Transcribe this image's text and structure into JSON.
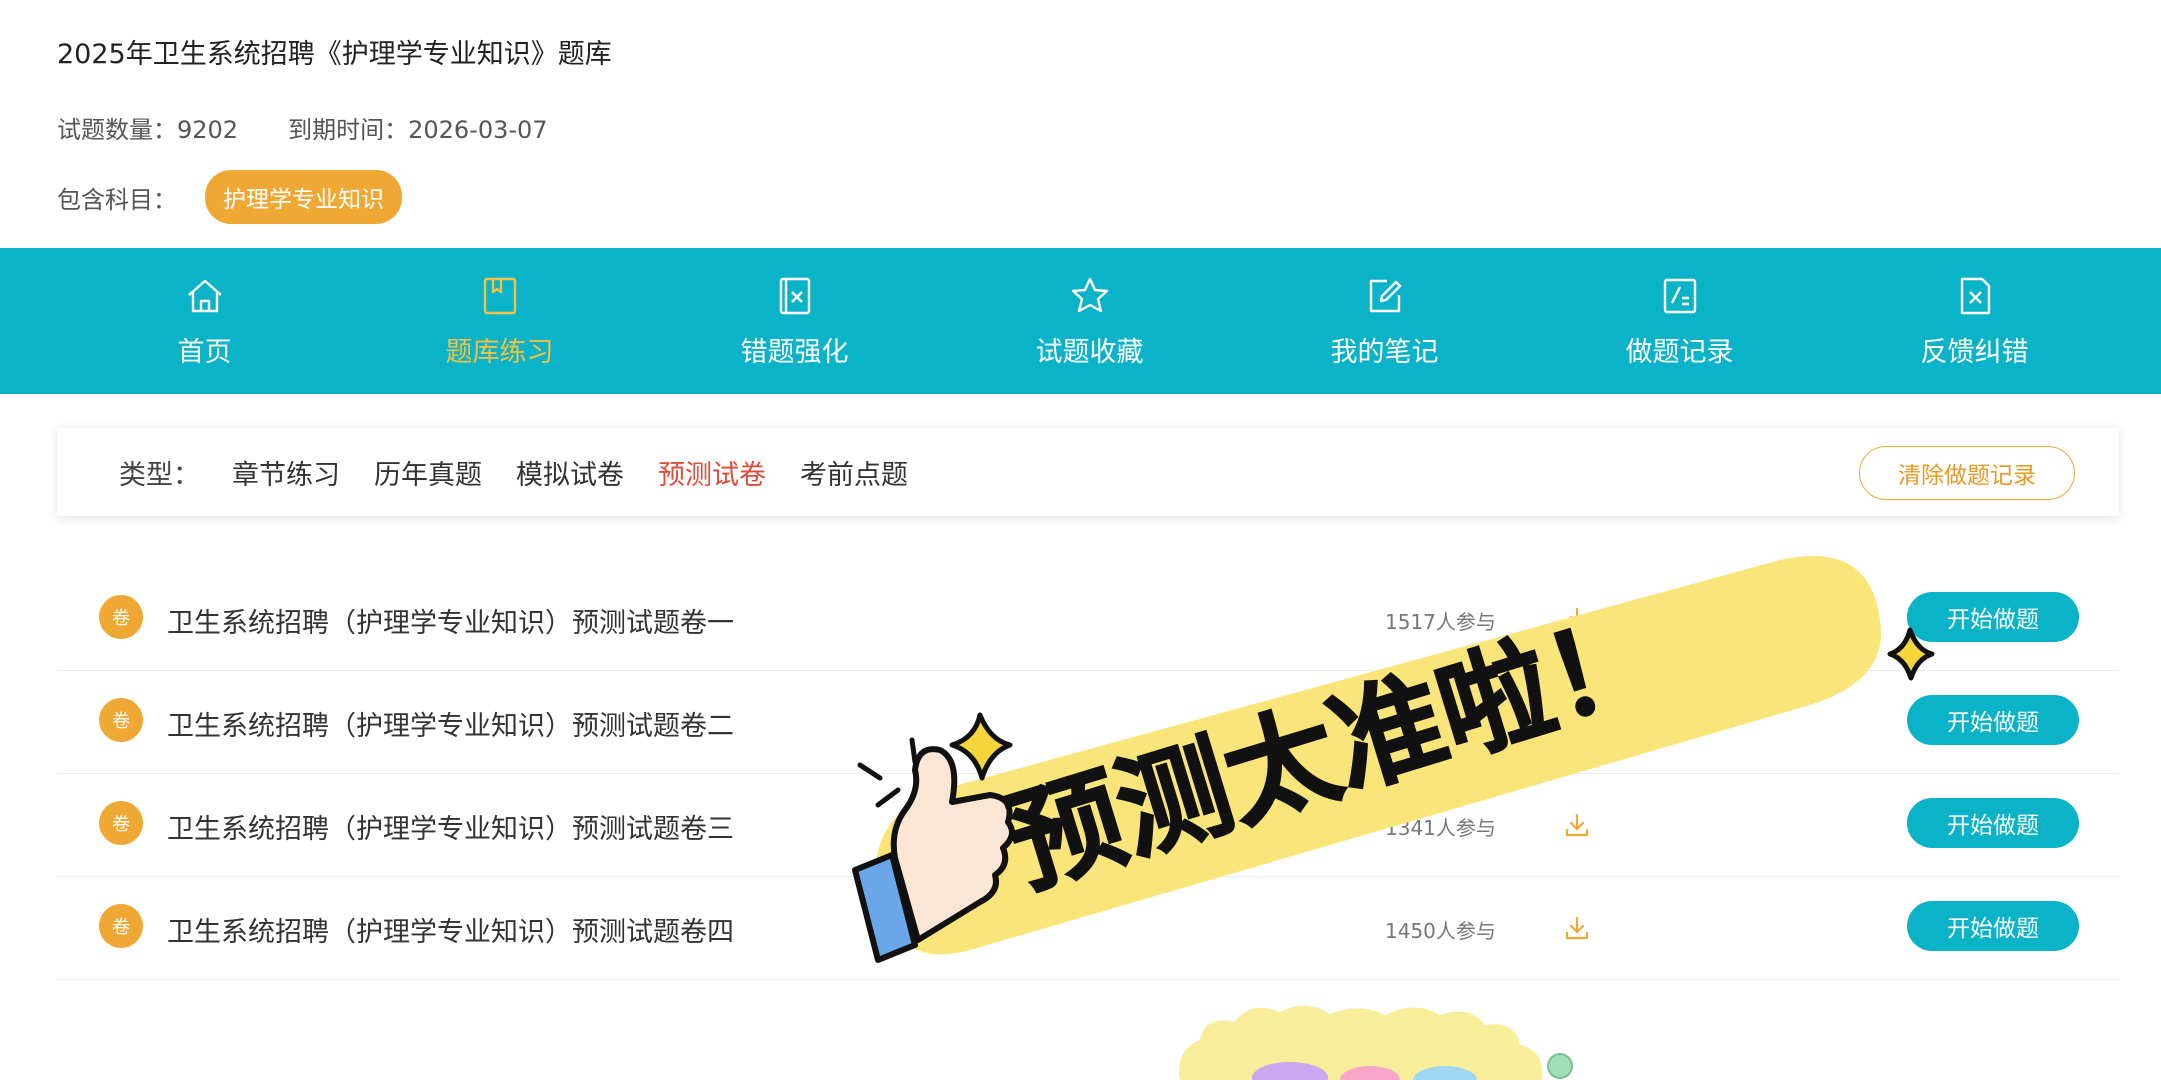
{
  "header": {
    "title": "2025年卫生系统招聘《护理学专业知识》题库",
    "question_count": "试题数量：9202",
    "expire": "到期时间：2026-03-07",
    "subjects_label": "包含科目：",
    "subject_tag": "护理学专业知识"
  },
  "nav": [
    {
      "label": "首页",
      "icon": "home-icon"
    },
    {
      "label": "题库练习",
      "icon": "book-icon"
    },
    {
      "label": "错题强化",
      "icon": "wrong-book-icon"
    },
    {
      "label": "试题收藏",
      "icon": "star-icon"
    },
    {
      "label": "我的笔记",
      "icon": "edit-note-icon"
    },
    {
      "label": "做题记录",
      "icon": "record-icon"
    },
    {
      "label": "反馈纠错",
      "icon": "feedback-icon"
    }
  ],
  "nav_active_index": 1,
  "types": {
    "label": "类型：",
    "options": [
      "章节练习",
      "历年真题",
      "模拟试卷",
      "预测试卷",
      "考前点题"
    ],
    "active_index": 3,
    "clear_button": "清除做题记录"
  },
  "papers": [
    {
      "badge": "卷",
      "title": "卫生系统招聘（护理学专业知识）预测试题卷一",
      "count": "1517人参与",
      "button": "开始做题"
    },
    {
      "badge": "卷",
      "title": "卫生系统招聘（护理学专业知识）预测试题卷二",
      "count": "",
      "button": "开始做题"
    },
    {
      "badge": "卷",
      "title": "卫生系统招聘（护理学专业知识）预测试题卷三",
      "count": "1341人参与",
      "button": "开始做题"
    },
    {
      "badge": "卷",
      "title": "卫生系统招聘（护理学专业知识）预测试题卷四",
      "count": "1450人参与",
      "button": "开始做题"
    }
  ],
  "sticker": {
    "text": "预测太准啦！"
  },
  "colors": {
    "accent": "#0ab3c8",
    "orange": "#f0a834",
    "active_red": "#e04b3a",
    "nav_active": "#f5c143",
    "sticker_yellow": "#f9e57a"
  }
}
